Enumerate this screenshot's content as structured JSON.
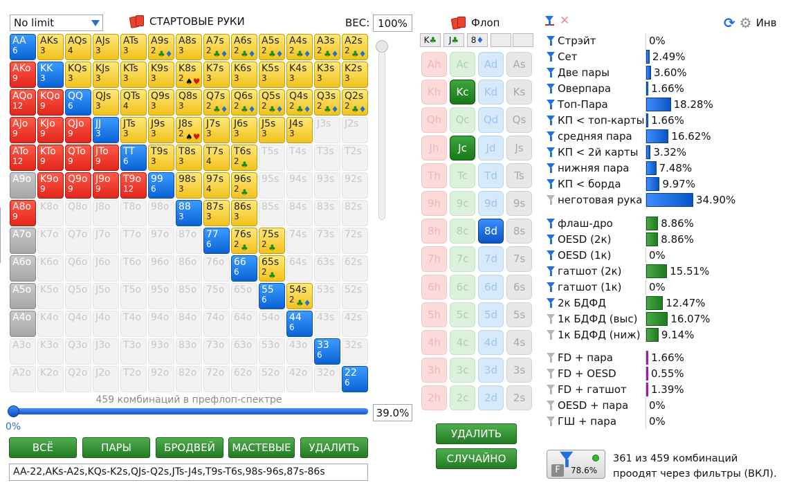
{
  "top": {
    "mode_select": "No limit",
    "hands_title": "СТАРТОВЫЕ РУКИ",
    "weight_label": "ВЕС:",
    "weight_value": "100%"
  },
  "grid_rows": [
    [
      [
        "AA",
        "6",
        "pair",
        ""
      ],
      [
        "AKs",
        "3",
        "suited",
        ""
      ],
      [
        "AQs",
        "4",
        "suited",
        ""
      ],
      [
        "AJs",
        "3",
        "suited",
        ""
      ],
      [
        "ATs",
        "3",
        "suited",
        ""
      ],
      [
        "A9s",
        "2",
        "suited",
        "clubs-diamonds"
      ],
      [
        "A8s",
        "3",
        "suited",
        ""
      ],
      [
        "A7s",
        "2",
        "suited",
        "clubs-diamonds"
      ],
      [
        "A6s",
        "2",
        "suited",
        "clubs-diamonds"
      ],
      [
        "A5s",
        "2",
        "suited",
        "clubs-diamonds"
      ],
      [
        "A4s",
        "2",
        "suited",
        "clubs-diamonds"
      ],
      [
        "A3s",
        "2",
        "suited",
        "clubs-diamonds"
      ],
      [
        "A2s",
        "2",
        "suited",
        "clubs-diamonds"
      ]
    ],
    [
      [
        "AKo",
        "9",
        "offsuit",
        ""
      ],
      [
        "KK",
        "3",
        "pair",
        ""
      ],
      [
        "KQs",
        "3",
        "suited",
        ""
      ],
      [
        "KJs",
        "3",
        "suited",
        ""
      ],
      [
        "KTs",
        "3",
        "suited",
        ""
      ],
      [
        "K9s",
        "3",
        "suited",
        ""
      ],
      [
        "K8s",
        "2",
        "suited",
        "spades-hearts"
      ],
      [
        "K7s",
        "3",
        "suited",
        ""
      ],
      [
        "K6s",
        "3",
        "suited",
        ""
      ],
      [
        "K5s",
        "3",
        "suited",
        ""
      ],
      [
        "K4s",
        "3",
        "suited",
        ""
      ],
      [
        "K3s",
        "3",
        "suited",
        ""
      ],
      [
        "K2s",
        "3",
        "suited",
        ""
      ]
    ],
    [
      [
        "AQo",
        "12",
        "offsuit",
        ""
      ],
      [
        "KQo",
        "9",
        "offsuit",
        ""
      ],
      [
        "QQ",
        "6",
        "pair",
        ""
      ],
      [
        "QJs",
        "3",
        "suited",
        ""
      ],
      [
        "QTs",
        "4",
        "suited",
        ""
      ],
      [
        "Q9s",
        "3",
        "suited",
        ""
      ],
      [
        "Q8s",
        "3",
        "suited",
        ""
      ],
      [
        "Q7s",
        "2",
        "suited",
        "clubs-diamonds"
      ],
      [
        "Q6s",
        "2",
        "suited",
        "clubs-diamonds"
      ],
      [
        "Q5s",
        "2",
        "suited",
        "clubs-diamonds"
      ],
      [
        "Q4s",
        "2",
        "suited",
        "clubs-diamonds"
      ],
      [
        "Q3s",
        "2",
        "suited",
        "clubs-diamonds"
      ],
      [
        "Q2s",
        "2",
        "suited",
        "clubs-diamonds"
      ]
    ],
    [
      [
        "AJo",
        "9",
        "offsuit",
        ""
      ],
      [
        "KJo",
        "9",
        "offsuit",
        ""
      ],
      [
        "QJo",
        "9",
        "offsuit",
        ""
      ],
      [
        "JJ",
        "3",
        "pair",
        ""
      ],
      [
        "JTs",
        "3",
        "suited",
        ""
      ],
      [
        "J9s",
        "3",
        "suited",
        ""
      ],
      [
        "J8s",
        "2",
        "suited",
        "spades-hearts"
      ],
      [
        "J7s",
        "3",
        "suited",
        ""
      ],
      [
        "J6s",
        "3",
        "suited",
        ""
      ],
      [
        "J5s",
        "3",
        "suited",
        ""
      ],
      [
        "J4s",
        "3",
        "suited",
        ""
      ],
      [
        "J3s",
        "",
        "empty",
        ""
      ],
      [
        "J2s",
        "",
        "empty",
        ""
      ]
    ],
    [
      [
        "ATo",
        "12",
        "offsuit",
        ""
      ],
      [
        "KTo",
        "9",
        "offsuit",
        ""
      ],
      [
        "QTo",
        "9",
        "offsuit",
        ""
      ],
      [
        "JTo",
        "9",
        "offsuit",
        ""
      ],
      [
        "TT",
        "6",
        "pair",
        ""
      ],
      [
        "T9s",
        "3",
        "suited",
        ""
      ],
      [
        "T8s",
        "3",
        "suited",
        ""
      ],
      [
        "T7s",
        "4",
        "suited",
        ""
      ],
      [
        "T6s",
        "2",
        "suited",
        "clubs"
      ],
      [
        "T5s",
        "",
        "empty",
        ""
      ],
      [
        "T4s",
        "",
        "empty",
        ""
      ],
      [
        "T3s",
        "",
        "empty",
        ""
      ],
      [
        "T2s",
        "",
        "empty",
        ""
      ]
    ],
    [
      [
        "A9o",
        "",
        "grayed",
        ""
      ],
      [
        "K9o",
        "9",
        "offsuit",
        ""
      ],
      [
        "Q9o",
        "9",
        "offsuit",
        ""
      ],
      [
        "J9o",
        "9",
        "offsuit",
        ""
      ],
      [
        "T9o",
        "12",
        "offsuit",
        ""
      ],
      [
        "99",
        "6",
        "pair",
        ""
      ],
      [
        "98s",
        "3",
        "suited",
        ""
      ],
      [
        "97s",
        "4",
        "suited",
        ""
      ],
      [
        "96s",
        "2",
        "suited",
        "clubs"
      ],
      [
        "95s",
        "",
        "empty",
        ""
      ],
      [
        "94s",
        "",
        "empty",
        ""
      ],
      [
        "93s",
        "",
        "empty",
        ""
      ],
      [
        "92s",
        "",
        "empty",
        ""
      ]
    ],
    [
      [
        "A8o",
        "9",
        "offsuit",
        ""
      ],
      [
        "K8o",
        "",
        "empty",
        ""
      ],
      [
        "Q8o",
        "",
        "empty",
        ""
      ],
      [
        "J8o",
        "",
        "empty",
        ""
      ],
      [
        "T8o",
        "",
        "empty",
        ""
      ],
      [
        "98o",
        "",
        "empty",
        ""
      ],
      [
        "88",
        "3",
        "pair",
        ""
      ],
      [
        "87s",
        "3",
        "suited",
        ""
      ],
      [
        "86s",
        "3",
        "suited",
        ""
      ],
      [
        "85s",
        "",
        "empty",
        ""
      ],
      [
        "84s",
        "",
        "empty",
        ""
      ],
      [
        "83s",
        "",
        "empty",
        ""
      ],
      [
        "82s",
        "",
        "empty",
        ""
      ]
    ],
    [
      [
        "A7o",
        "",
        "grayed",
        ""
      ],
      [
        "K7o",
        "",
        "empty",
        ""
      ],
      [
        "Q7o",
        "",
        "empty",
        ""
      ],
      [
        "J7o",
        "",
        "empty",
        ""
      ],
      [
        "T7o",
        "",
        "empty",
        ""
      ],
      [
        "97o",
        "",
        "empty",
        ""
      ],
      [
        "87o",
        "",
        "empty",
        ""
      ],
      [
        "77",
        "6",
        "pair",
        ""
      ],
      [
        "76s",
        "2",
        "suited",
        "clubs"
      ],
      [
        "75s",
        "2",
        "suited",
        "clubs"
      ],
      [
        "74s",
        "",
        "empty",
        ""
      ],
      [
        "73s",
        "",
        "empty",
        ""
      ],
      [
        "72s",
        "",
        "empty",
        ""
      ]
    ],
    [
      [
        "A6o",
        "",
        "grayed",
        ""
      ],
      [
        "K6o",
        "",
        "empty",
        ""
      ],
      [
        "Q6o",
        "",
        "empty",
        ""
      ],
      [
        "J6o",
        "",
        "empty",
        ""
      ],
      [
        "T6o",
        "",
        "empty",
        ""
      ],
      [
        "96o",
        "",
        "empty",
        ""
      ],
      [
        "86o",
        "",
        "empty",
        ""
      ],
      [
        "76o",
        "",
        "empty",
        ""
      ],
      [
        "66",
        "6",
        "pair",
        ""
      ],
      [
        "65s",
        "2",
        "suited",
        "clubs"
      ],
      [
        "64s",
        "",
        "empty",
        ""
      ],
      [
        "63s",
        "",
        "empty",
        ""
      ],
      [
        "62s",
        "",
        "empty",
        ""
      ]
    ],
    [
      [
        "A5o",
        "",
        "grayed",
        ""
      ],
      [
        "K5o",
        "",
        "empty",
        ""
      ],
      [
        "Q5o",
        "",
        "empty",
        ""
      ],
      [
        "J5o",
        "",
        "empty",
        ""
      ],
      [
        "T5o",
        "",
        "empty",
        ""
      ],
      [
        "95o",
        "",
        "empty",
        ""
      ],
      [
        "85o",
        "",
        "empty",
        ""
      ],
      [
        "75o",
        "",
        "empty",
        ""
      ],
      [
        "65o",
        "",
        "empty",
        ""
      ],
      [
        "55",
        "6",
        "pair",
        ""
      ],
      [
        "54s",
        "2",
        "suited",
        "clubs-diamonds"
      ],
      [
        "53s",
        "",
        "empty",
        ""
      ],
      [
        "52s",
        "",
        "empty",
        ""
      ]
    ],
    [
      [
        "A4o",
        "",
        "grayed",
        ""
      ],
      [
        "K4o",
        "",
        "empty",
        ""
      ],
      [
        "Q4o",
        "",
        "empty",
        ""
      ],
      [
        "J4o",
        "",
        "empty",
        ""
      ],
      [
        "T4o",
        "",
        "empty",
        ""
      ],
      [
        "94o",
        "",
        "empty",
        ""
      ],
      [
        "84o",
        "",
        "empty",
        ""
      ],
      [
        "74o",
        "",
        "empty",
        ""
      ],
      [
        "64o",
        "",
        "empty",
        ""
      ],
      [
        "54o",
        "",
        "empty",
        ""
      ],
      [
        "44",
        "6",
        "pair",
        ""
      ],
      [
        "43s",
        "",
        "empty",
        ""
      ],
      [
        "42s",
        "",
        "empty",
        ""
      ]
    ],
    [
      [
        "A3o",
        "",
        "empty",
        ""
      ],
      [
        "K3o",
        "",
        "empty",
        ""
      ],
      [
        "Q3o",
        "",
        "empty",
        ""
      ],
      [
        "J3o",
        "",
        "empty",
        ""
      ],
      [
        "T3o",
        "",
        "empty",
        ""
      ],
      [
        "93o",
        "",
        "empty",
        ""
      ],
      [
        "83o",
        "",
        "empty",
        ""
      ],
      [
        "73o",
        "",
        "empty",
        ""
      ],
      [
        "63o",
        "",
        "empty",
        ""
      ],
      [
        "53o",
        "",
        "empty",
        ""
      ],
      [
        "43o",
        "",
        "empty",
        ""
      ],
      [
        "33",
        "6",
        "pair",
        ""
      ],
      [
        "32s",
        "",
        "empty",
        ""
      ]
    ],
    [
      [
        "A2o",
        "",
        "empty",
        ""
      ],
      [
        "K2o",
        "",
        "empty",
        ""
      ],
      [
        "Q2o",
        "",
        "empty",
        ""
      ],
      [
        "J2o",
        "",
        "empty",
        ""
      ],
      [
        "T2o",
        "",
        "empty",
        ""
      ],
      [
        "92o",
        "",
        "empty",
        ""
      ],
      [
        "82o",
        "",
        "empty",
        ""
      ],
      [
        "72o",
        "",
        "empty",
        ""
      ],
      [
        "62o",
        "",
        "empty",
        ""
      ],
      [
        "52o",
        "",
        "empty",
        ""
      ],
      [
        "42o",
        "",
        "empty",
        ""
      ],
      [
        "32o",
        "",
        "empty",
        ""
      ],
      [
        "22",
        "6",
        "pair",
        ""
      ]
    ]
  ],
  "range": {
    "combo_text": "459 комбинаций в префлоп-спектре",
    "low_pct": "0%",
    "high_pct": "39.0%",
    "range_fraction": 0.39,
    "range_string": "AA-22,AKs-A2s,KQs-K2s,QJs-Q2s,JTs-J4s,T9s-T6s,98s-96s,87s-86s"
  },
  "buttons": {
    "all": "ВСЁ",
    "pairs": "ПАРЫ",
    "broadway": "БРОДВЕЙ",
    "suited": "МАСТЕВЫЕ",
    "delete": "УДАЛИТЬ"
  },
  "flop": {
    "title": "Флоп",
    "slots": [
      [
        "K",
        "♣",
        "clubs"
      ],
      [
        "J",
        "♣",
        "clubs"
      ],
      [
        "8",
        "♦",
        "diamonds"
      ],
      [
        "",
        "",
        ""
      ],
      [
        "",
        "",
        ""
      ]
    ],
    "ranks": [
      "A",
      "K",
      "Q",
      "J",
      "T",
      "9",
      "8",
      "7",
      "6",
      "5",
      "4",
      "3",
      "2"
    ],
    "suits": [
      "h",
      "c",
      "d",
      "s"
    ],
    "selected": [
      "Kc",
      "Jc",
      "8d"
    ],
    "delete_button": "УДАЛИТЬ",
    "random_button": "СЛУЧАЙНО"
  },
  "stats": {
    "inv_label": "Инв",
    "colors": {
      "blue": "#1f6fe0",
      "green": "#2f922f",
      "purple": "#9a1faa"
    },
    "groups": [
      [
        {
          "label": "Стрэйт",
          "value": "0%",
          "pct": 0,
          "color": "blue",
          "funnel": "blue"
        },
        {
          "label": "Сет",
          "value": "2.49%",
          "pct": 2.49,
          "color": "blue",
          "funnel": "blue"
        },
        {
          "label": "Две пары",
          "value": "3.60%",
          "pct": 3.6,
          "color": "blue",
          "funnel": "blue"
        },
        {
          "label": "Оверпара",
          "value": "1.66%",
          "pct": 1.66,
          "color": "blue",
          "funnel": "blue"
        },
        {
          "label": "Топ-Пара",
          "value": "18.28%",
          "pct": 18.28,
          "color": "blue",
          "funnel": "blue"
        },
        {
          "label": "КП < топ-карты",
          "value": "1.66%",
          "pct": 1.66,
          "color": "blue",
          "funnel": "blue"
        },
        {
          "label": "средняя пара",
          "value": "16.62%",
          "pct": 16.62,
          "color": "blue",
          "funnel": "blue"
        },
        {
          "label": "КП < 2й карты",
          "value": "3.32%",
          "pct": 3.32,
          "color": "blue",
          "funnel": "blue"
        },
        {
          "label": "нижняя пара",
          "value": "7.48%",
          "pct": 7.48,
          "color": "blue",
          "funnel": "blue"
        },
        {
          "label": "КП < борда",
          "value": "9.97%",
          "pct": 9.97,
          "color": "blue",
          "funnel": "blue"
        },
        {
          "label": "неготовая рука",
          "value": "34.90%",
          "pct": 34.9,
          "color": "blue",
          "funnel": "gray"
        }
      ],
      [
        {
          "label": "флаш-дро",
          "value": "8.86%",
          "pct": 8.86,
          "color": "green",
          "funnel": "blue"
        },
        {
          "label": "OESD (2к)",
          "value": "8.86%",
          "pct": 8.86,
          "color": "green",
          "funnel": "blue"
        },
        {
          "label": "OESD (1к)",
          "value": "0%",
          "pct": 0,
          "color": "green",
          "funnel": "blue"
        },
        {
          "label": "гатшот (2к)",
          "value": "15.51%",
          "pct": 15.51,
          "color": "green",
          "funnel": "blue"
        },
        {
          "label": "гатшот (1к)",
          "value": "0%",
          "pct": 0,
          "color": "green",
          "funnel": "blue"
        },
        {
          "label": "2к БДФД",
          "value": "12.47%",
          "pct": 12.47,
          "color": "green",
          "funnel": "blue"
        },
        {
          "label": "1к БДФД (выс)",
          "value": "16.07%",
          "pct": 16.07,
          "color": "green",
          "funnel": "gray"
        },
        {
          "label": "1к БДФД (ниж)",
          "value": "9.14%",
          "pct": 9.14,
          "color": "green",
          "funnel": "gray"
        }
      ],
      [
        {
          "label": "FD + пара",
          "value": "1.66%",
          "pct": 1.66,
          "color": "purple",
          "funnel": "gray"
        },
        {
          "label": "FD + OESD",
          "value": "0.55%",
          "pct": 0.55,
          "color": "purple",
          "funnel": "gray"
        },
        {
          "label": "FD + гатшот",
          "value": "1.39%",
          "pct": 1.39,
          "color": "purple",
          "funnel": "gray"
        },
        {
          "label": "OESD + пара",
          "value": "0%",
          "pct": 0,
          "color": "purple",
          "funnel": "gray"
        },
        {
          "label": "ГШ + пара",
          "value": "0%",
          "pct": 0,
          "color": "purple",
          "funnel": "gray"
        }
      ]
    ]
  },
  "filter": {
    "letter": "F",
    "percent": "78.6%",
    "text_line1": "361 из 459 комбинаций",
    "text_line2": "проодят через фильтры (ВКЛ)."
  }
}
